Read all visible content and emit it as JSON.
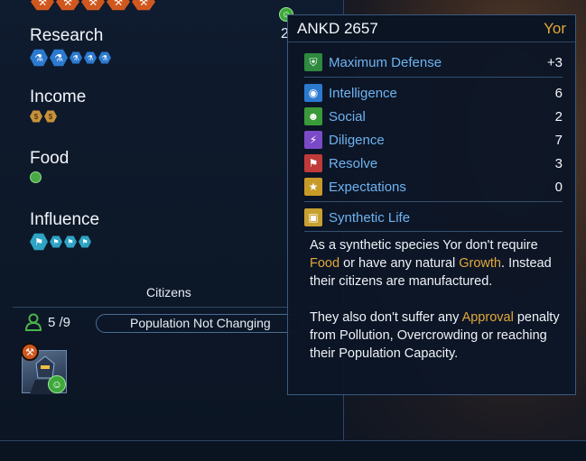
{
  "left_panel": {
    "stats": [
      {
        "label": "Research",
        "icon": "research-flask-icon"
      },
      {
        "label": "Income",
        "icon": "dust-coin-icon"
      },
      {
        "label": "Food",
        "icon": "food-apple-icon"
      },
      {
        "label": "Influence",
        "icon": "influence-flag-icon"
      }
    ],
    "stray_digit": "2",
    "citizens": {
      "title": "Citizens",
      "population": "5 /9",
      "status": "Population Not Changing"
    }
  },
  "tooltip": {
    "title": "ANKD 2657",
    "owner": "Yor",
    "rows": [
      {
        "label": "Maximum Defense",
        "value": "+3",
        "icon": "shield-icon",
        "color": "#2e8a3e"
      },
      {
        "label": "Intelligence",
        "value": "6",
        "icon": "lightbulb-icon",
        "color": "#2b7ad0"
      },
      {
        "label": "Social",
        "value": "2",
        "icon": "people-icon",
        "color": "#3a9a3a"
      },
      {
        "label": "Diligence",
        "value": "7",
        "icon": "lightning-icon",
        "color": "#7b4ac8"
      },
      {
        "label": "Resolve",
        "value": "3",
        "icon": "flag-runner-icon",
        "color": "#c03a3a"
      },
      {
        "label": "Expectations",
        "value": "0",
        "icon": "star-icon",
        "color": "#c89a28"
      }
    ],
    "trait": {
      "label": "Synthetic Life",
      "icon": "circuit-chip-icon",
      "color": "#c8a030"
    },
    "desc1": {
      "a": "As a synthetic species Yor don't require ",
      "b": "Food",
      "c": " or have any natural ",
      "d": "Growth",
      "e": ". Instead their citizens are manufactured."
    },
    "desc2": {
      "a": "They also don't suffer any ",
      "b": "Approval",
      "c": " penalty from Pollution, Overcrowding or reaching their Population Capacity."
    }
  },
  "colors": {
    "accent_blue": "#6fb3f0",
    "highlight_gold": "#e3a83a",
    "panel_bg": "#0c1626"
  }
}
